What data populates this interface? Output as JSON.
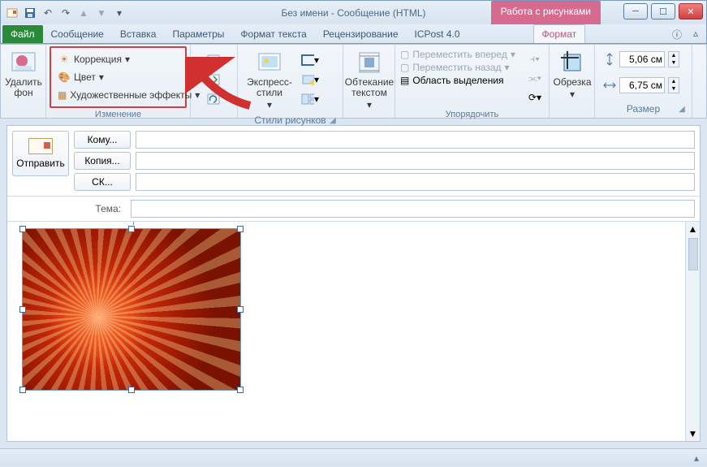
{
  "window": {
    "title": "Без имени  -  Сообщение (HTML)",
    "contextual_tab": "Работа с рисунками"
  },
  "tabs": {
    "file": "Файл",
    "message": "Сообщение",
    "insert": "Вставка",
    "options": "Параметры",
    "format_text": "Формат текста",
    "review": "Рецензирование",
    "icpost": "ICPost 4.0",
    "format": "Формат"
  },
  "ribbon": {
    "remove_bg": "Удалить фон",
    "adjust": {
      "corrections": "Коррекция",
      "color": "Цвет",
      "artistic": "Художественные эффекты",
      "group": "Изменение"
    },
    "styles": {
      "quick": "Экспресс-стили",
      "group": "Стили рисунков"
    },
    "wrap": "Обтекание текстом",
    "arrange": {
      "forward": "Переместить вперед",
      "backward": "Переместить назад",
      "selection_pane": "Область выделения",
      "group": "Упорядочить"
    },
    "crop": "Обрезка",
    "size": {
      "height": "5,06 см",
      "width": "6,75 см",
      "group": "Размер"
    }
  },
  "compose": {
    "send": "Отправить",
    "to": "Кому...",
    "cc": "Копия...",
    "bcc": "СК...",
    "subject_label": "Тема:"
  },
  "fields": {
    "to": "",
    "cc": "",
    "bcc": "",
    "subject": ""
  }
}
